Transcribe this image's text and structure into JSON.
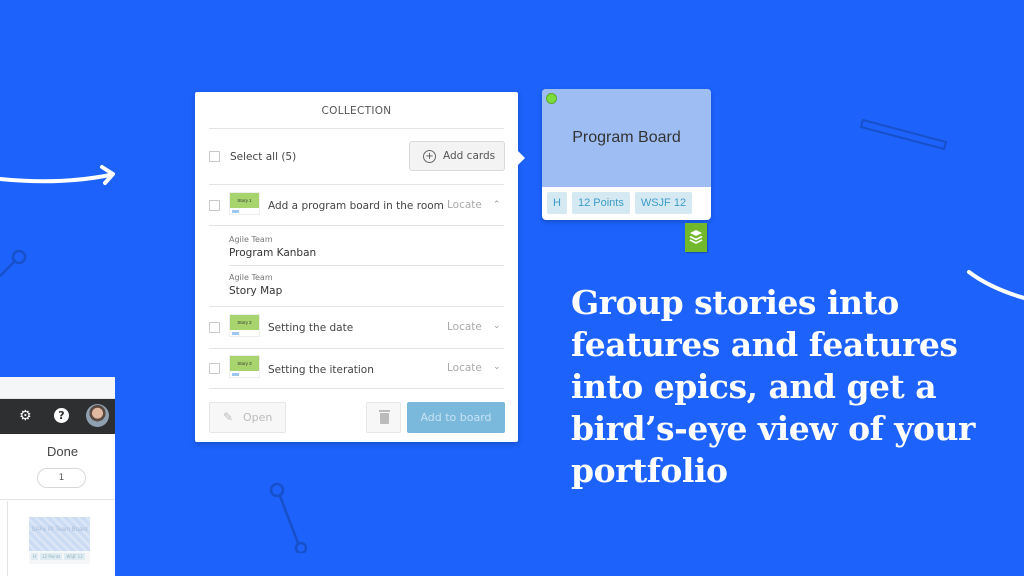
{
  "background_color": "#1c62fb",
  "collection_panel": {
    "title": "COLLECTION",
    "select_all_label": "Select all (5)",
    "add_cards_label": "Add cards",
    "items": [
      {
        "thumb_label": "Story 1",
        "title": "Add a program board in the room",
        "locate_label": "Locate",
        "expanded": true,
        "details": [
          {
            "label": "Agile Team",
            "value": "Program Kanban"
          },
          {
            "label": "Agile Team",
            "value": "Story Map"
          }
        ]
      },
      {
        "thumb_label": "Story 2",
        "title": "Setting the date",
        "locate_label": "Locate",
        "expanded": false
      },
      {
        "thumb_label": "Story 3",
        "title": "Setting the iteration",
        "locate_label": "Locate",
        "expanded": false
      }
    ],
    "open_label": "Open",
    "add_to_board_label": "Add to board"
  },
  "program_card": {
    "title": "Program Board",
    "tags": [
      "H",
      "12 Points",
      "WSJF 12"
    ],
    "status_color": "#7ddc3d"
  },
  "app_fragment": {
    "column_title": "Done",
    "column_count": "1",
    "mini_card_title": "SAFe PI Team Board"
  },
  "headline": "Group stories into features and features into epics, and get a bird’s-eye view of your portfolio"
}
